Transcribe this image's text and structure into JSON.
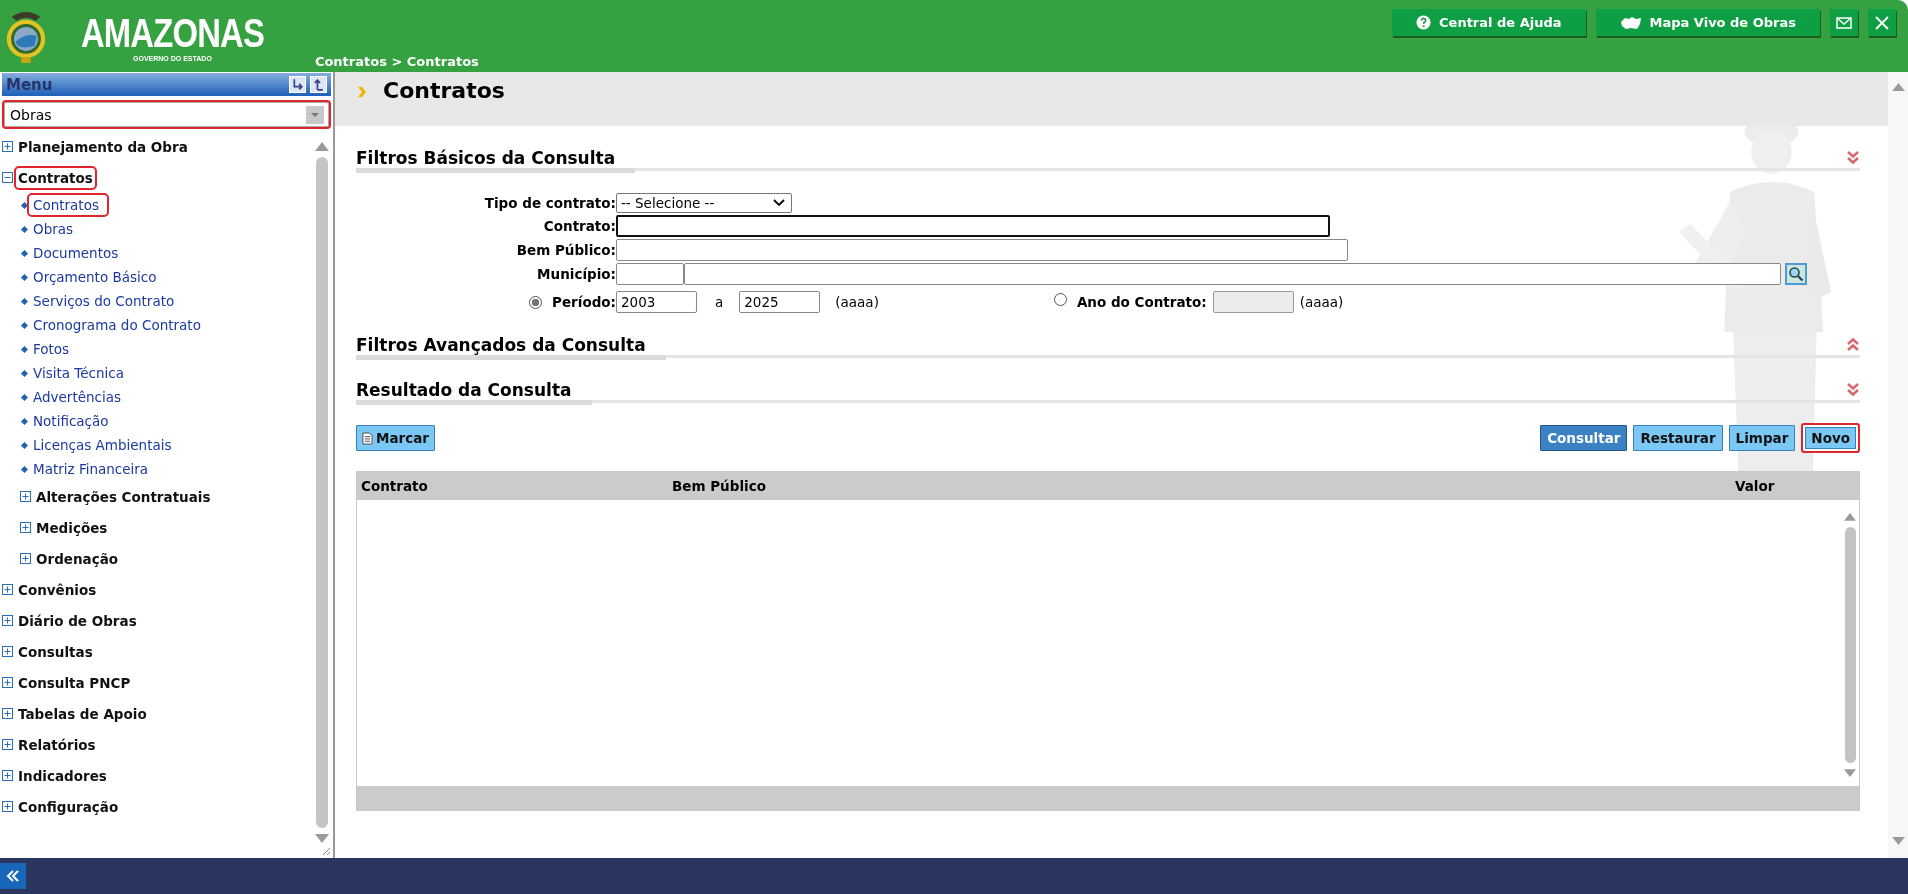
{
  "header": {
    "logo_title": "AMAZONAS",
    "logo_subtitle": "GOVERNO DO ESTADO",
    "breadcrumb": "Contratos > Contratos",
    "buttons": [
      {
        "kind": "help",
        "label": "Central de Ajuda"
      },
      {
        "kind": "map",
        "label": "Mapa Vivo de Obras"
      },
      {
        "kind": "mail"
      },
      {
        "kind": "close"
      }
    ]
  },
  "sidebar": {
    "title": "Menu",
    "module_select": {
      "value": "Obras",
      "highlighted": true
    },
    "tree": [
      {
        "label": "Planejamento da Obra",
        "kind": "group",
        "expanded": false,
        "highlighted": false
      },
      {
        "label": "Contratos",
        "kind": "group",
        "expanded": true,
        "highlighted": true,
        "children": [
          {
            "label": "Contratos",
            "kind": "leaf",
            "highlighted": true
          },
          {
            "label": "Obras",
            "kind": "leaf",
            "highlighted": false
          },
          {
            "label": "Documentos",
            "kind": "leaf",
            "highlighted": false
          },
          {
            "label": "Orçamento Básico",
            "kind": "leaf",
            "highlighted": false
          },
          {
            "label": "Serviços do Contrato",
            "kind": "leaf",
            "highlighted": false
          },
          {
            "label": "Cronograma do Contrato",
            "kind": "leaf",
            "highlighted": false
          },
          {
            "label": "Fotos",
            "kind": "leaf",
            "highlighted": false
          },
          {
            "label": "Visita Técnica",
            "kind": "leaf",
            "highlighted": false
          },
          {
            "label": "Advertências",
            "kind": "leaf",
            "highlighted": false
          },
          {
            "label": "Notificação",
            "kind": "leaf",
            "highlighted": false
          },
          {
            "label": "Licenças Ambientais",
            "kind": "leaf",
            "highlighted": false
          },
          {
            "label": "Matriz Financeira",
            "kind": "leaf",
            "highlighted": false
          },
          {
            "label": "Alterações Contratuais",
            "kind": "group",
            "expanded": false,
            "highlighted": false
          },
          {
            "label": "Medições",
            "kind": "group",
            "expanded": false,
            "highlighted": false
          },
          {
            "label": "Ordenação",
            "kind": "group",
            "expanded": false,
            "highlighted": false
          }
        ]
      },
      {
        "label": "Convênios",
        "kind": "group",
        "expanded": false,
        "highlighted": false
      },
      {
        "label": "Diário de Obras",
        "kind": "group",
        "expanded": false,
        "highlighted": false
      },
      {
        "label": "Consultas",
        "kind": "group",
        "expanded": false,
        "highlighted": false
      },
      {
        "label": "Consulta PNCP",
        "kind": "group",
        "expanded": false,
        "highlighted": false
      },
      {
        "label": "Tabelas de Apoio",
        "kind": "group",
        "expanded": false,
        "highlighted": false
      },
      {
        "label": "Relatórios",
        "kind": "group",
        "expanded": false,
        "highlighted": false
      },
      {
        "label": "Indicadores",
        "kind": "group",
        "expanded": false,
        "highlighted": false
      },
      {
        "label": "Configuração",
        "kind": "group",
        "expanded": false,
        "highlighted": false
      }
    ]
  },
  "page": {
    "title": "Contratos",
    "basic_filters": {
      "title": "Filtros Básicos da Consulta",
      "expanded": true,
      "tipo_contrato": {
        "label": "Tipo de contrato:",
        "value": "-- Selecione --"
      },
      "contrato": {
        "label": "Contrato:",
        "focused": true
      },
      "bem_publico": {
        "label": "Bem Público:"
      },
      "municipio": {
        "label": "Município:"
      },
      "periodo": {
        "label": "Período:",
        "selected": true,
        "from": "2003",
        "separator": "a",
        "to": "2025",
        "hint": "(aaaa)"
      },
      "ano_contrato": {
        "label": "Ano do Contrato:",
        "selected": false,
        "hint": "(aaaa)"
      }
    },
    "advanced_filters": {
      "title": "Filtros Avançados da Consulta",
      "expanded": false
    },
    "results": {
      "title": "Resultado da Consulta",
      "expanded": true,
      "buttons": [
        {
          "label": "Marcar",
          "kind": "mark",
          "highlighted": false
        },
        {
          "label": "Consultar",
          "kind": "primary",
          "highlighted": false
        },
        {
          "label": "Restaurar",
          "kind": "default",
          "highlighted": false
        },
        {
          "label": "Limpar",
          "kind": "default",
          "highlighted": false
        },
        {
          "label": "Novo",
          "kind": "default",
          "highlighted": true
        }
      ],
      "columns": [
        "Contrato",
        "Bem Público",
        "Valor"
      ]
    }
  }
}
